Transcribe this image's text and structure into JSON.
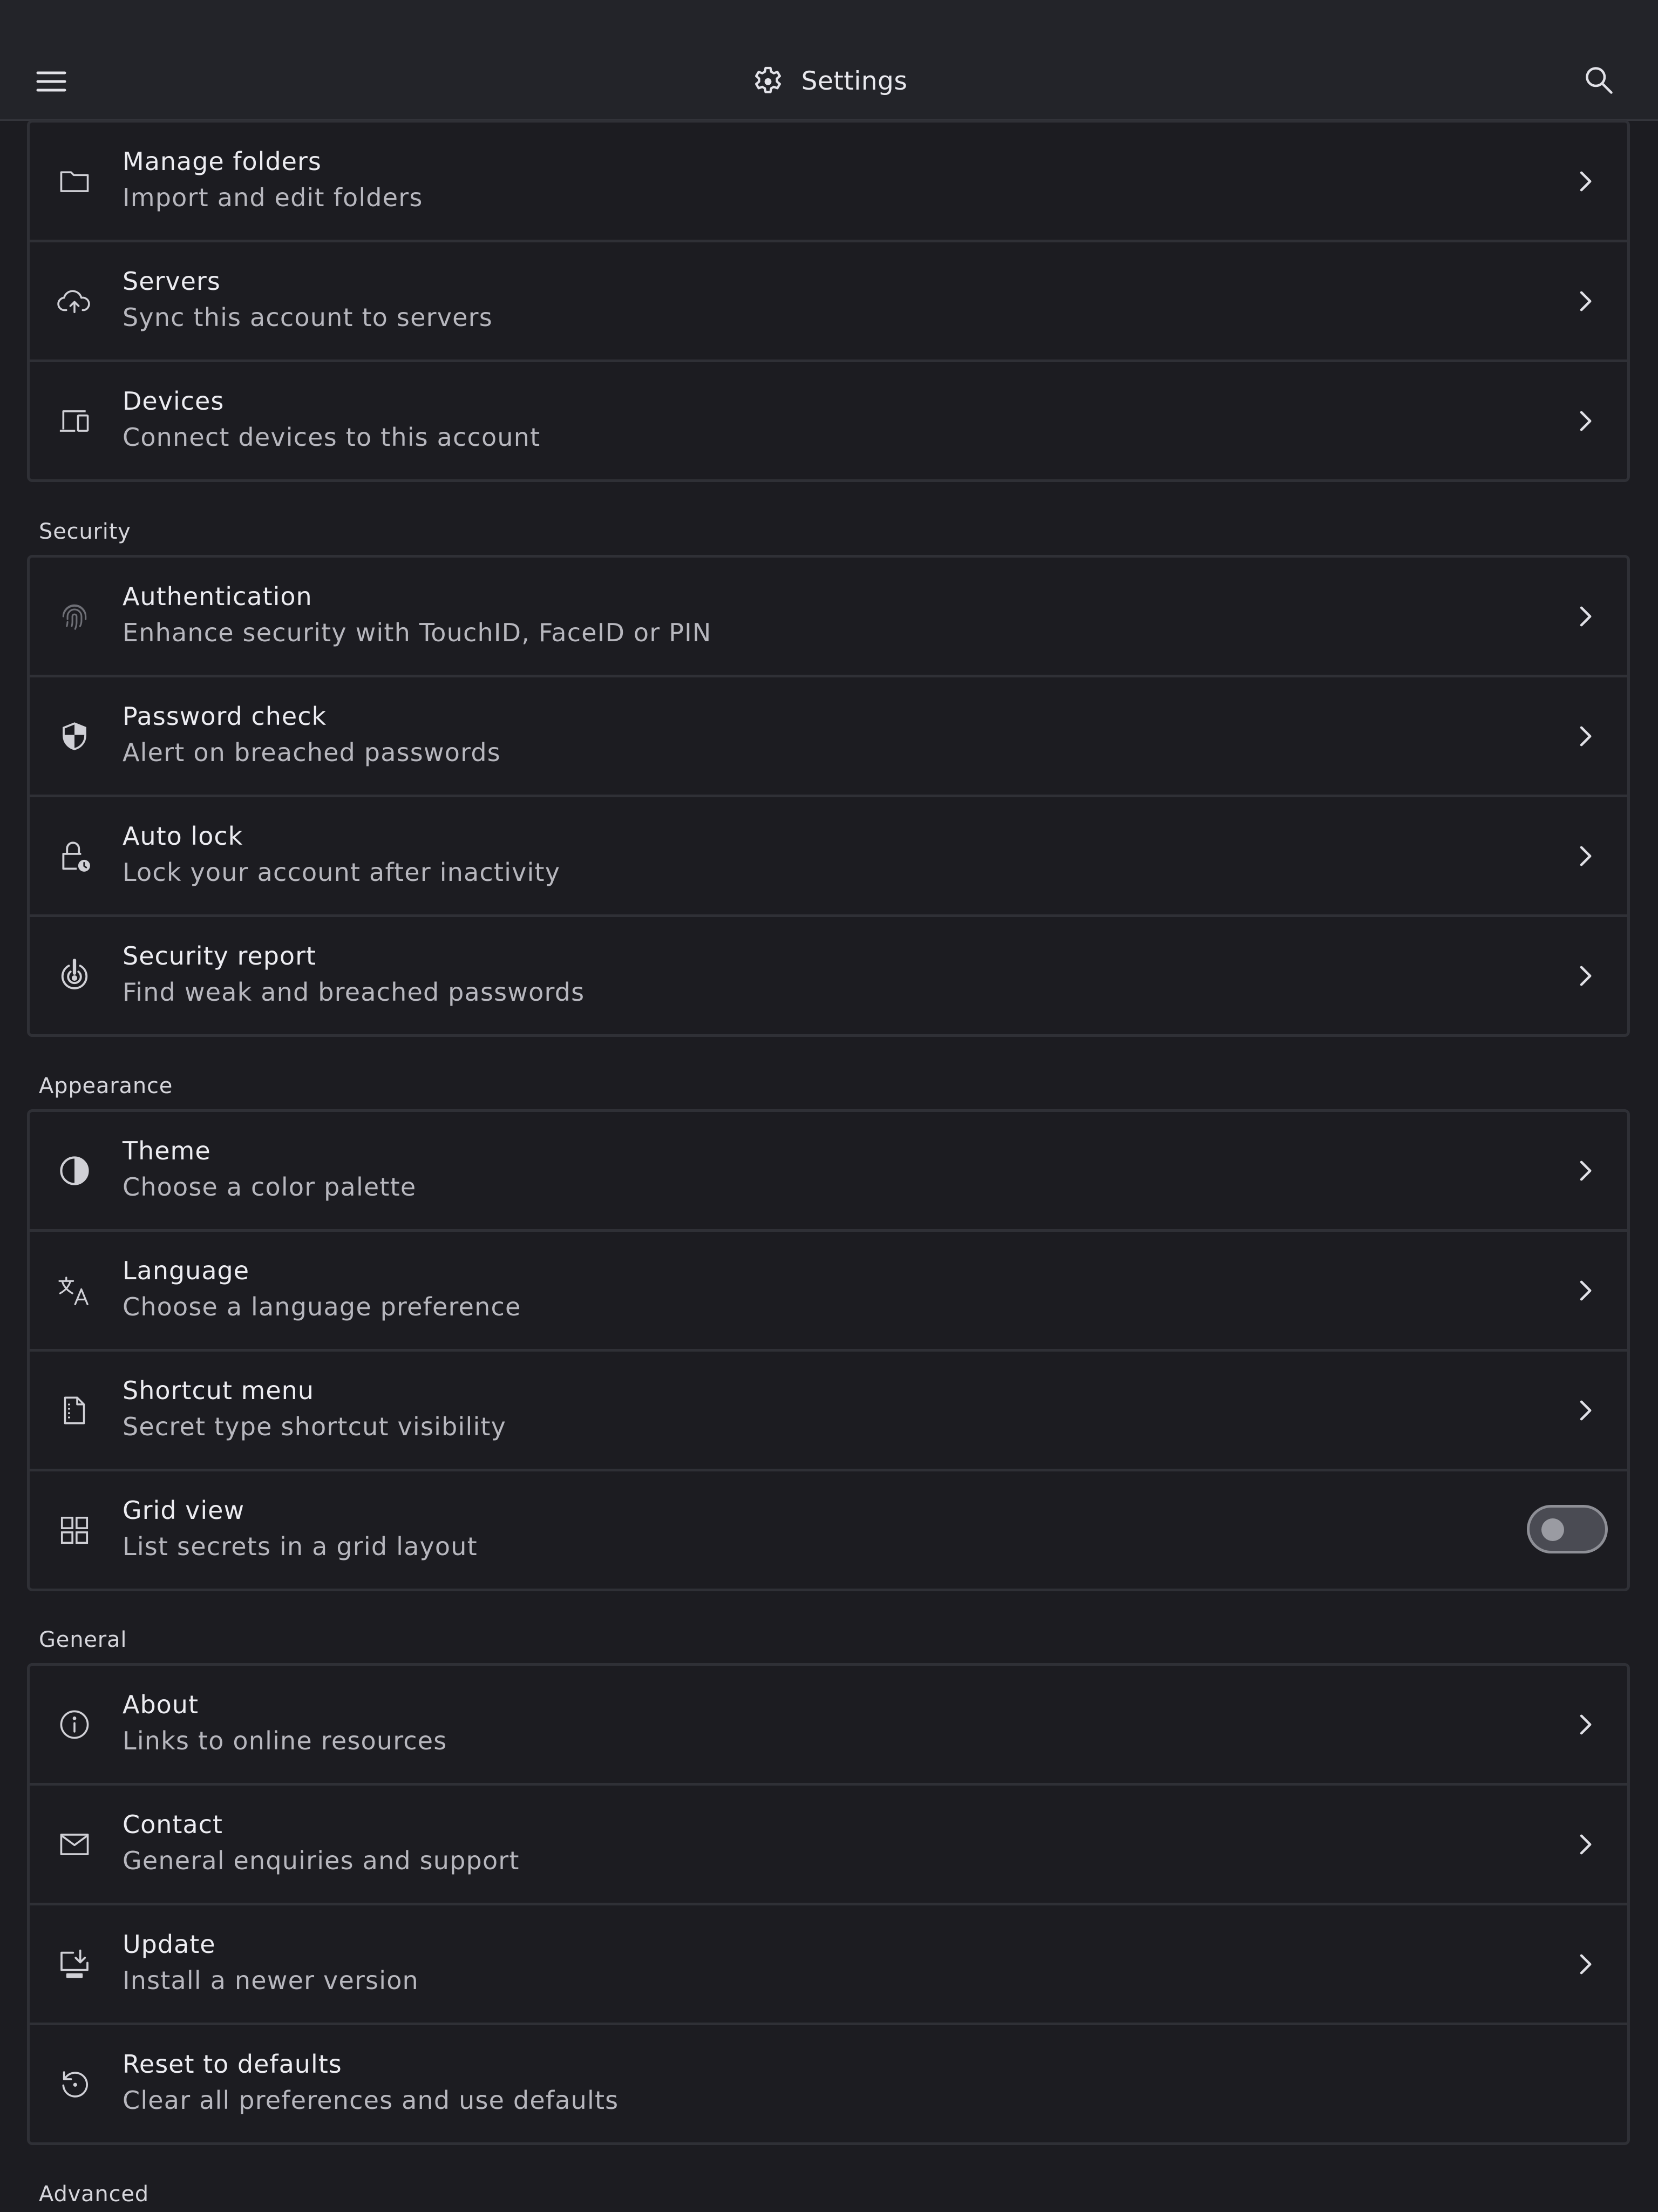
{
  "header": {
    "title": "Settings",
    "menu_icon": "menu-icon",
    "title_icon": "gear-icon",
    "search_icon": "search-icon"
  },
  "groups": [
    {
      "section": "",
      "items": [
        {
          "label": "Manage folders",
          "sub": "Import and edit folders",
          "icon": "folder-icon",
          "control": "chevron"
        },
        {
          "label": "Servers",
          "sub": "Sync this account to servers",
          "icon": "cloud-upload-icon",
          "control": "chevron"
        },
        {
          "label": "Devices",
          "sub": "Connect devices to this account",
          "icon": "devices-icon",
          "control": "chevron"
        }
      ]
    },
    {
      "section": "Security",
      "items": [
        {
          "label": "Authentication",
          "sub": "Enhance security with TouchID, FaceID or PIN",
          "icon": "fingerprint-icon",
          "control": "chevron"
        },
        {
          "label": "Password check",
          "sub": "Alert on breached passwords",
          "icon": "shield-icon",
          "control": "chevron"
        },
        {
          "label": "Auto lock",
          "sub": "Lock your account after inactivity",
          "icon": "lock-clock-icon",
          "control": "chevron"
        },
        {
          "label": "Security report",
          "sub": "Find weak and breached passwords",
          "icon": "target-icon",
          "control": "chevron"
        }
      ]
    },
    {
      "section": "Appearance",
      "items": [
        {
          "label": "Theme",
          "sub": "Choose a color palette",
          "icon": "contrast-icon",
          "control": "chevron"
        },
        {
          "label": "Language",
          "sub": "Choose a language preference",
          "icon": "translate-icon",
          "control": "chevron"
        },
        {
          "label": "Shortcut menu",
          "sub": "Secret type shortcut visibility",
          "icon": "dashed-file-icon",
          "control": "chevron"
        },
        {
          "label": "Grid view",
          "sub": "List secrets in a grid layout",
          "icon": "grid-icon",
          "control": "toggle",
          "toggle_on": false
        }
      ]
    },
    {
      "section": "General",
      "items": [
        {
          "label": "About",
          "sub": "Links to online resources",
          "icon": "info-icon",
          "control": "chevron"
        },
        {
          "label": "Contact",
          "sub": "General enquiries and support",
          "icon": "mail-icon",
          "control": "chevron"
        },
        {
          "label": "Update",
          "sub": "Install a newer version",
          "icon": "download-monitor-icon",
          "control": "chevron"
        },
        {
          "label": "Reset to defaults",
          "sub": "Clear all preferences and use defaults",
          "icon": "reset-icon",
          "control": "none"
        }
      ]
    },
    {
      "section": "Advanced",
      "items": []
    }
  ],
  "colors": {
    "background": "#1c1c21",
    "appbar": "#232429",
    "border": "#2f3036",
    "text": "#ececf1",
    "subtext": "#b7b7be",
    "toggle_track": "#4a4b53"
  }
}
